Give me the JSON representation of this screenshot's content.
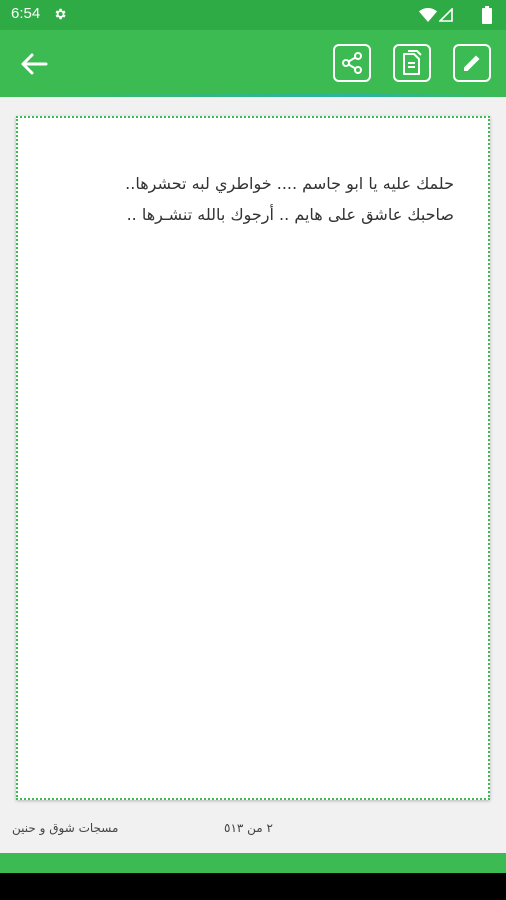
{
  "status_bar": {
    "time": "6:54"
  },
  "app_bar": {
    "back_icon": "arrow-left-icon",
    "actions": [
      {
        "icon": "share-icon"
      },
      {
        "icon": "copy-icon"
      },
      {
        "icon": "edit-icon"
      }
    ]
  },
  "message": {
    "text": "حلمك عليه يا ابو جاسم .... خواطري لبه تحشرها..\nصاحبك عاشق على هايم .. أرجوك بالله تنشـرها .."
  },
  "footer": {
    "category": "مسجات شوق و حنين",
    "counter": "٢ من ٥١٣"
  },
  "colors": {
    "primary": "#3cbb52",
    "status": "#2fab45"
  }
}
